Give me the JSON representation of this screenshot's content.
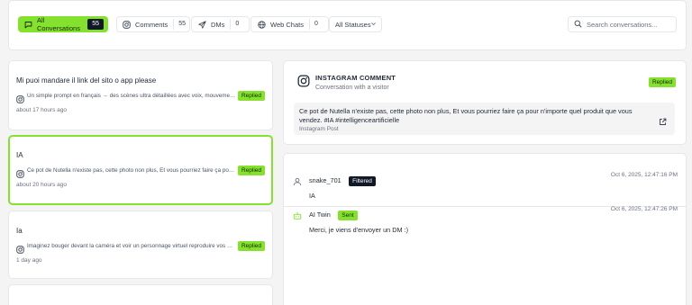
{
  "filters": [
    {
      "label": "All Conversations",
      "count": "55",
      "icon": "chat-icon",
      "active": true
    },
    {
      "label": "Comments",
      "count": "55",
      "icon": "instagram-icon",
      "active": false
    },
    {
      "label": "DMs",
      "count": "0",
      "icon": "send-icon",
      "active": false
    },
    {
      "label": "Web Chats",
      "count": "0",
      "icon": "globe-icon",
      "active": false
    }
  ],
  "status_filter": {
    "selected": "All Statuses"
  },
  "search": {
    "placeholder": "Search conversations...",
    "value": ""
  },
  "conversations": [
    {
      "title": "Mi puoi mandare il link del sito o app please",
      "preview": "Un simple prompt en français → des scènes ultra détaillées avec voix, mouvements...",
      "status": "Replied",
      "time": "about 17 hours ago",
      "selected": false
    },
    {
      "title": "IA",
      "preview": "Ce pot de Nutella n'existe pas, cette photo non plus, Et vous pourriez faire ça pour n'importe quel produit que vous vendez.",
      "status": "Replied",
      "time": "about 20 hours ago",
      "selected": true
    },
    {
      "title": "Ia",
      "preview": "Imaginez bouger devant la caméra et voir un personnage virtuel reproduire vos mouvements...",
      "status": "Replied",
      "time": "1 day ago",
      "selected": false
    },
    {
      "title": "",
      "preview": "",
      "status": "",
      "time": "",
      "selected": false
    }
  ],
  "detail": {
    "title": "INSTAGRAM COMMENT",
    "subtitle": "Conversation with a visitor",
    "status": "Replied",
    "post_text": "Ce pot de Nutella n'existe pas, cette photo non plus, Et vous pourriez faire ça pour n'importe quel produit que vous vendez. #IA #intelligenceartificielle",
    "post_source": "Instagram Post"
  },
  "messages": [
    {
      "sender": "snake_701",
      "badge": "Filtered",
      "text": "IA",
      "timestamp": "Oct 6, 2025, 12:47:16 PM",
      "avatar": "user-icon"
    },
    {
      "sender": "AI Twin",
      "badge": "Sent",
      "text": "Merci, je viens d'envoyer un DM :)",
      "timestamp": "Oct 6, 2025, 12:47:26 PM",
      "avatar": "bot-icon"
    }
  ],
  "colors": {
    "accent": "#84e22e",
    "dark_badge": "#111827",
    "background": "#f4f4f5"
  }
}
